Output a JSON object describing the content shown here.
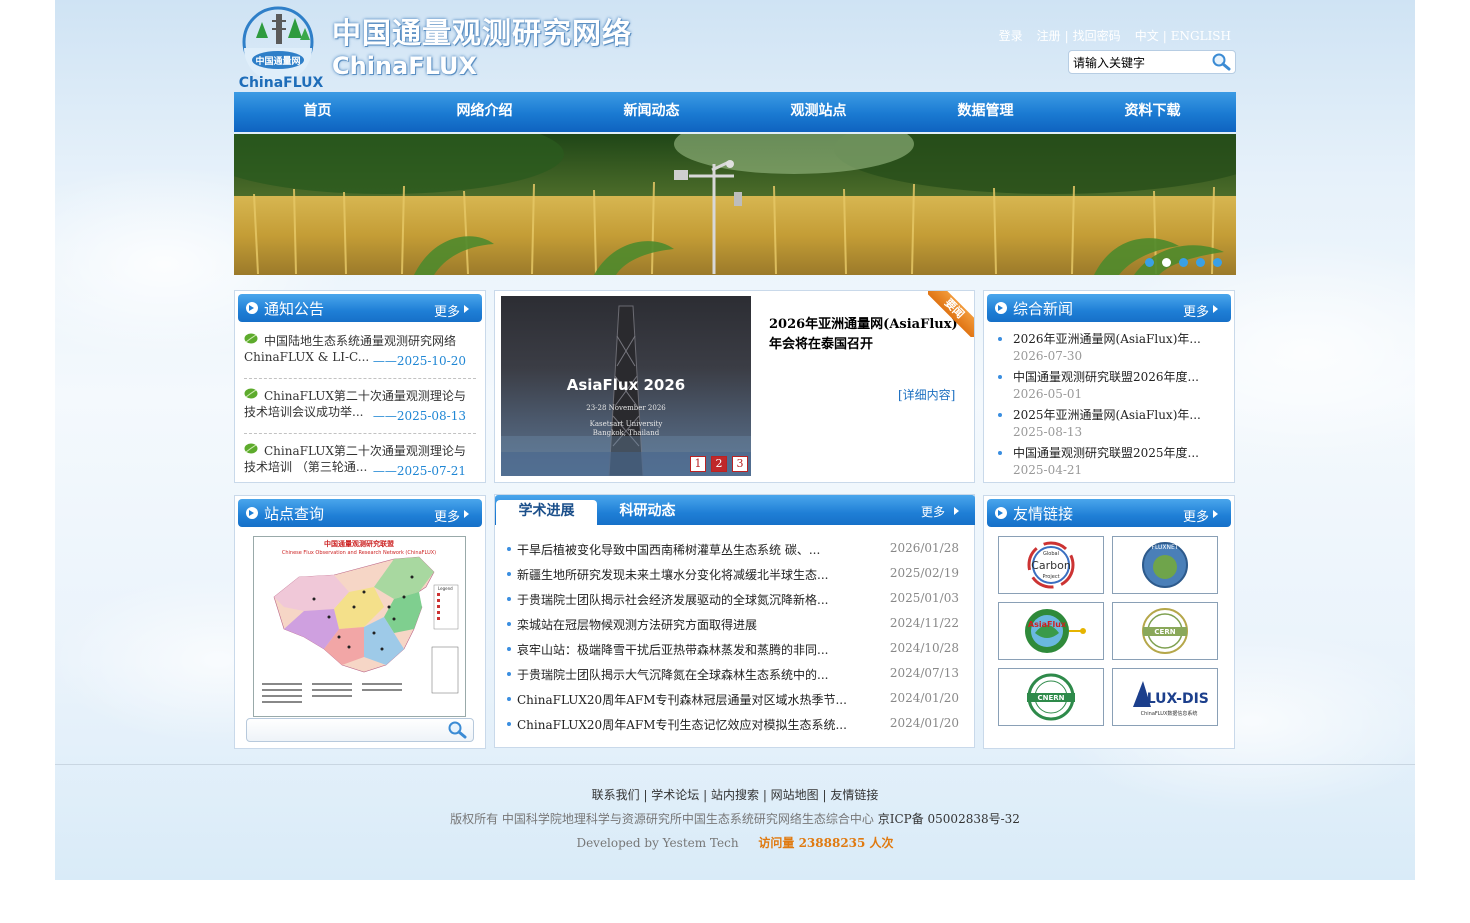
{
  "header": {
    "title_cn": "中国通量观测研究网络",
    "title_en": "ChinaFLUX",
    "logo_badge": "中国通量网",
    "logo_text": "ChinaFLUX",
    "login": "登录",
    "register": "注册",
    "forgot": "找回密码",
    "lang_cn": "中文",
    "lang_en": "ENGLISH",
    "divider": "|",
    "search_value": "请输入关键字"
  },
  "nav": [
    "首页",
    "网络介绍",
    "新闻动态",
    "观测站点",
    "数据管理",
    "资料下载"
  ],
  "banner": {
    "slides": 5,
    "active": 1
  },
  "more_label": "更多",
  "notice": {
    "title": "通知公告",
    "items": [
      {
        "text": "中国陆地生态系统通量观测研究网络ChinaFLUX & LI-C...",
        "date": "——2025-10-20"
      },
      {
        "text": "ChinaFLUX第二十次通量观测理论与技术培训会议成功举...",
        "date": "——2025-08-13"
      },
      {
        "text": "ChinaFLUX第二十次通量观测理论与技术培训 （第三轮通...",
        "date": "——2025-07-21"
      }
    ]
  },
  "featured": {
    "image_title": "AsiaFlux 2026",
    "image_sub1": "23-28 November 2026",
    "image_sub2": "Kasetsart University",
    "image_sub3": "Bangkok, Thailand",
    "headline": "2026年亚洲通量网(AsiaFlux)年会将在泰国召开",
    "detail": "[详细内容]",
    "ribbon": "要闻",
    "pages": [
      "1",
      "2",
      "3"
    ],
    "active_page": 1
  },
  "news": {
    "title": "综合新闻",
    "items": [
      {
        "title": "2026年亚洲通量网(AsiaFlux)年...",
        "date": "2026-07-30"
      },
      {
        "title": "中国通量观测研究联盟2026年度...",
        "date": "2026-05-01"
      },
      {
        "title": "2025年亚洲通量网(AsiaFlux)年...",
        "date": "2025-08-13"
      },
      {
        "title": "中国通量观测研究联盟2025年度...",
        "date": "2025-04-21"
      }
    ]
  },
  "station": {
    "title": "站点查询",
    "map_title": "中国通量观测研究联盟",
    "map_subtitle": "Chinese Flux Observation and Research Network (ChinaFLUX)",
    "map_legend": "Legend",
    "search_value": ""
  },
  "academic": {
    "tab_active": "学术进展",
    "tab_other": "科研动态",
    "items": [
      {
        "title": "干旱后植被变化导致中国西南稀树灌草丛生态系统 碳、...",
        "date": "2026/01/28"
      },
      {
        "title": "新疆生地所研究发现未来土壤水分变化将减缓北半球生态...",
        "date": "2025/02/19"
      },
      {
        "title": "于贵瑞院士团队揭示社会经济发展驱动的全球氮沉降新格...",
        "date": "2025/01/03"
      },
      {
        "title": "栾城站在冠层物候观测方法研究方面取得进展",
        "date": "2024/11/22"
      },
      {
        "title": "哀牢山站：极端降雪干扰后亚热带森林蒸发和蒸腾的非同...",
        "date": "2024/10/28"
      },
      {
        "title": "于贵瑞院士团队揭示大气沉降氮在全球森林生态系统中的...",
        "date": "2024/07/13"
      },
      {
        "title": "ChinaFLUX20周年AFM专刊森林冠层通量对区域水热季节...",
        "date": "2024/01/20"
      },
      {
        "title": "ChinaFLUX20周年AFM专刊生态记忆效应对模拟生态系统...",
        "date": "2024/01/20"
      }
    ]
  },
  "links": {
    "title": "友情链接",
    "items": [
      {
        "name": "global-carbon-project",
        "text": "Carbon",
        "sub": "Global",
        "sub2": "Project"
      },
      {
        "name": "fluxnet",
        "text": "FLUXNET",
        "sub": "",
        "sub2": ""
      },
      {
        "name": "asiaflux",
        "text": "AsiaFlux",
        "sub": "",
        "sub2": ""
      },
      {
        "name": "cern",
        "text": "CERN",
        "sub": "",
        "sub2": ""
      },
      {
        "name": "cnern",
        "text": "CNERN",
        "sub": "",
        "sub2": ""
      },
      {
        "name": "flux-dis",
        "text": "FLUX-DIS",
        "sub": "ChinaFLUX数据信息系统",
        "sub2": ""
      }
    ]
  },
  "footer": {
    "links": [
      "联系我们",
      "学术论坛",
      "站内搜索",
      "网站地图",
      "友情链接"
    ],
    "copyright": "版权所有 中国科学院地理科学与资源研究所中国生态系统研究网络生态综合中心",
    "icp": "京ICP备 05002838号-32",
    "developer": "Developed by Yestem Tech",
    "visits": "访问量 23888235 人次"
  },
  "colors": {
    "nav": "#1a7ad2",
    "accent": "#1f86d4",
    "visits": "#e07a10",
    "active_page": "#c0282a"
  }
}
